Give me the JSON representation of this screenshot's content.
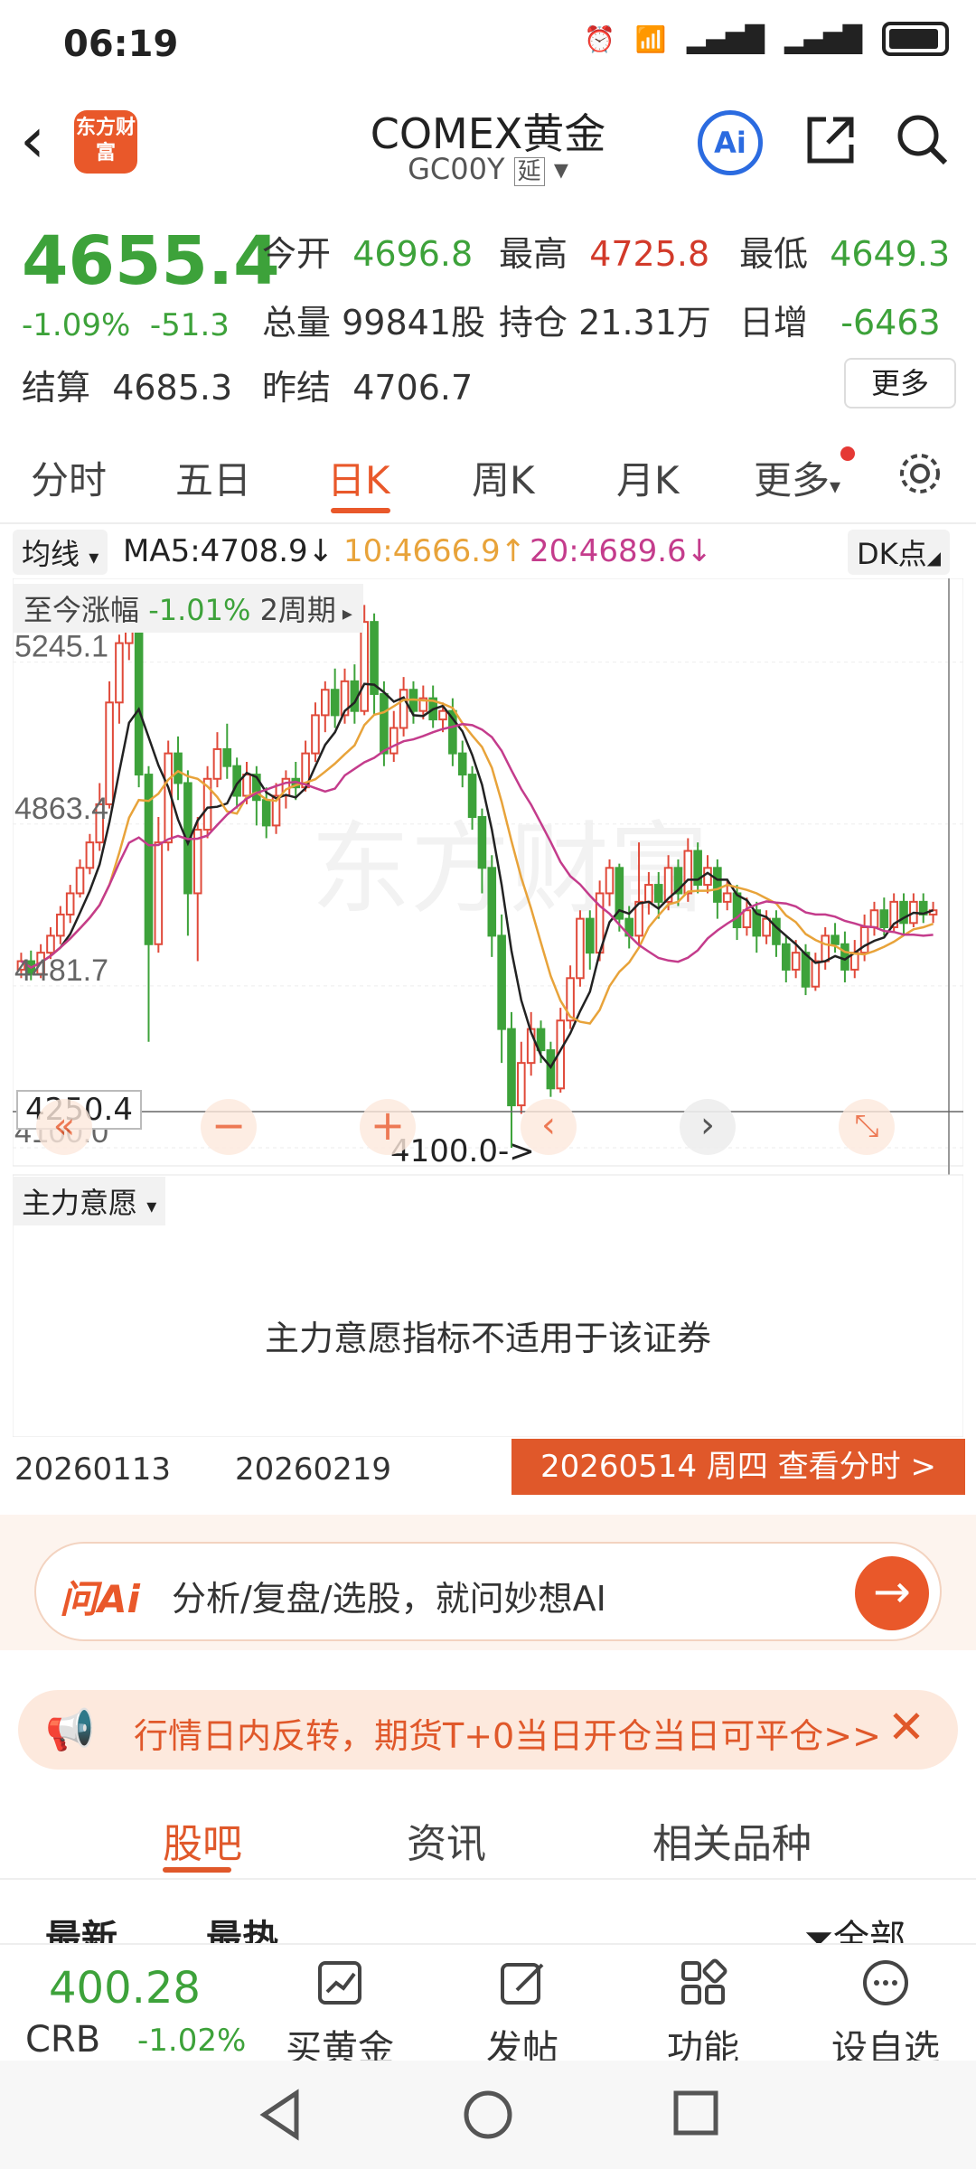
{
  "status": {
    "time": "06:19"
  },
  "header": {
    "title": "COMEX黄金",
    "code": "GC00Y",
    "delay_tag": "延",
    "logo_text": "东方财富",
    "ai_label": "Ai"
  },
  "quote": {
    "price": "4655.4",
    "change_pct": "-1.09%",
    "change": "-51.3",
    "open_label": "今开",
    "open": "4696.8",
    "high_label": "最高",
    "high": "4725.8",
    "low_label": "最低",
    "low": "4649.3",
    "volume_label": "总量",
    "volume": "99841股",
    "oi_label": "持仓",
    "oi": "21.31万",
    "daily_inc_label": "日增",
    "daily_inc": "-6463",
    "settle_label": "结算",
    "settle": "4685.3",
    "prev_settle_label": "昨结",
    "prev_settle": "4706.7",
    "more_label": "更多"
  },
  "tabs": [
    "分时",
    "五日",
    "日K",
    "周K",
    "月K",
    "更多"
  ],
  "active_tab": 2,
  "ma": {
    "selector": "均线",
    "ma5": "MA5:4708.9↓",
    "ma10": "10:4666.9↑",
    "ma20": "20:4689.6↓",
    "dk_label": "DK点",
    "ma5_color": "#222222",
    "ma10_color": "#e8a33a",
    "ma20_color": "#c43c8c"
  },
  "chart_overlay": {
    "range_label": "至今涨幅",
    "range_value": "-1.01%",
    "period": "2周期",
    "current_price_tag": "4250.4",
    "marker_text": "4100.0->",
    "indicator_selector": "主力意愿",
    "indicator_note": "主力意愿指标不适用于该证券"
  },
  "chart_data": {
    "type": "candlestick",
    "y_ticks": [
      "5245.1",
      "4863.4",
      "4481.7",
      "4100.0"
    ],
    "ylim": [
      4100.0,
      5400.0
    ],
    "x_labels": [
      "20260113",
      "20260219"
    ],
    "watermark": "东方财富",
    "up_color": "#e04a3a",
    "down_color": "#3da23a",
    "candles": [
      {
        "o": 4520,
        "c": 4540,
        "h": 4560,
        "l": 4500
      },
      {
        "o": 4540,
        "c": 4510,
        "h": 4565,
        "l": 4495
      },
      {
        "o": 4510,
        "c": 4560,
        "h": 4580,
        "l": 4500
      },
      {
        "o": 4560,
        "c": 4600,
        "h": 4620,
        "l": 4545
      },
      {
        "o": 4600,
        "c": 4650,
        "h": 4670,
        "l": 4580
      },
      {
        "o": 4650,
        "c": 4700,
        "h": 4720,
        "l": 4630
      },
      {
        "o": 4700,
        "c": 4760,
        "h": 4780,
        "l": 4690
      },
      {
        "o": 4760,
        "c": 4820,
        "h": 4840,
        "l": 4745
      },
      {
        "o": 4820,
        "c": 4910,
        "h": 4960,
        "l": 4800
      },
      {
        "o": 4910,
        "c": 5150,
        "h": 5200,
        "l": 4900
      },
      {
        "o": 5150,
        "c": 5290,
        "h": 5310,
        "l": 5100
      },
      {
        "o": 5290,
        "c": 5340,
        "h": 5360,
        "l": 5250
      },
      {
        "o": 5340,
        "c": 4980,
        "h": 5370,
        "l": 4950
      },
      {
        "o": 4980,
        "c": 4580,
        "h": 5000,
        "l": 4350
      },
      {
        "o": 4580,
        "c": 4820,
        "h": 4880,
        "l": 4560
      },
      {
        "o": 4820,
        "c": 5030,
        "h": 5060,
        "l": 4800
      },
      {
        "o": 5030,
        "c": 4960,
        "h": 5070,
        "l": 4920
      },
      {
        "o": 4960,
        "c": 4700,
        "h": 4990,
        "l": 4600
      },
      {
        "o": 4700,
        "c": 4850,
        "h": 4880,
        "l": 4540
      },
      {
        "o": 4850,
        "c": 4970,
        "h": 5000,
        "l": 4830
      },
      {
        "o": 4970,
        "c": 5040,
        "h": 5080,
        "l": 4950
      },
      {
        "o": 5040,
        "c": 5000,
        "h": 5100,
        "l": 4970
      },
      {
        "o": 5000,
        "c": 4930,
        "h": 5020,
        "l": 4900
      },
      {
        "o": 4930,
        "c": 4980,
        "h": 5010,
        "l": 4910
      },
      {
        "o": 4980,
        "c": 4920,
        "h": 5000,
        "l": 4860
      },
      {
        "o": 4920,
        "c": 4860,
        "h": 4950,
        "l": 4830
      },
      {
        "o": 4860,
        "c": 4930,
        "h": 4960,
        "l": 4840
      },
      {
        "o": 4930,
        "c": 4970,
        "h": 4990,
        "l": 4900
      },
      {
        "o": 4970,
        "c": 4950,
        "h": 5010,
        "l": 4920
      },
      {
        "o": 4950,
        "c": 5030,
        "h": 5060,
        "l": 4940
      },
      {
        "o": 5030,
        "c": 5120,
        "h": 5150,
        "l": 5010
      },
      {
        "o": 5120,
        "c": 5180,
        "h": 5200,
        "l": 5080
      },
      {
        "o": 5180,
        "c": 5120,
        "h": 5230,
        "l": 5090
      },
      {
        "o": 5120,
        "c": 5200,
        "h": 5230,
        "l": 5100
      },
      {
        "o": 5200,
        "c": 5130,
        "h": 5240,
        "l": 5100
      },
      {
        "o": 5130,
        "c": 5340,
        "h": 5380,
        "l": 5120
      },
      {
        "o": 5340,
        "c": 5170,
        "h": 5360,
        "l": 5120
      },
      {
        "o": 5170,
        "c": 5030,
        "h": 5200,
        "l": 5000
      },
      {
        "o": 5030,
        "c": 5090,
        "h": 5130,
        "l": 5010
      },
      {
        "o": 5090,
        "c": 5180,
        "h": 5210,
        "l": 5070
      },
      {
        "o": 5180,
        "c": 5130,
        "h": 5200,
        "l": 5100
      },
      {
        "o": 5130,
        "c": 5160,
        "h": 5190,
        "l": 5110
      },
      {
        "o": 5160,
        "c": 5110,
        "h": 5190,
        "l": 5090
      },
      {
        "o": 5110,
        "c": 5130,
        "h": 5150,
        "l": 5080
      },
      {
        "o": 5130,
        "c": 5030,
        "h": 5160,
        "l": 5000
      },
      {
        "o": 5030,
        "c": 4980,
        "h": 5060,
        "l": 4950
      },
      {
        "o": 4980,
        "c": 4880,
        "h": 5000,
        "l": 4850
      },
      {
        "o": 4880,
        "c": 4760,
        "h": 4900,
        "l": 4700
      },
      {
        "o": 4760,
        "c": 4600,
        "h": 4790,
        "l": 4550
      },
      {
        "o": 4600,
        "c": 4380,
        "h": 4650,
        "l": 4300
      },
      {
        "o": 4380,
        "c": 4200,
        "h": 4420,
        "l": 4100
      },
      {
        "o": 4200,
        "c": 4300,
        "h": 4350,
        "l": 4180
      },
      {
        "o": 4300,
        "c": 4380,
        "h": 4420,
        "l": 4270
      },
      {
        "o": 4380,
        "c": 4330,
        "h": 4400,
        "l": 4300
      },
      {
        "o": 4330,
        "c": 4240,
        "h": 4350,
        "l": 4220
      },
      {
        "o": 4240,
        "c": 4400,
        "h": 4430,
        "l": 4230
      },
      {
        "o": 4400,
        "c": 4500,
        "h": 4530,
        "l": 4380
      },
      {
        "o": 4500,
        "c": 4640,
        "h": 4660,
        "l": 4480
      },
      {
        "o": 4640,
        "c": 4560,
        "h": 4660,
        "l": 4520
      },
      {
        "o": 4560,
        "c": 4700,
        "h": 4730,
        "l": 4540
      },
      {
        "o": 4700,
        "c": 4760,
        "h": 4780,
        "l": 4670
      },
      {
        "o": 4760,
        "c": 4640,
        "h": 4770,
        "l": 4610
      },
      {
        "o": 4640,
        "c": 4600,
        "h": 4670,
        "l": 4570
      },
      {
        "o": 4600,
        "c": 4680,
        "h": 4820,
        "l": 4580
      },
      {
        "o": 4680,
        "c": 4720,
        "h": 4750,
        "l": 4650
      },
      {
        "o": 4720,
        "c": 4680,
        "h": 4750,
        "l": 4640
      },
      {
        "o": 4680,
        "c": 4760,
        "h": 4790,
        "l": 4660
      },
      {
        "o": 4760,
        "c": 4700,
        "h": 4780,
        "l": 4670
      },
      {
        "o": 4700,
        "c": 4800,
        "h": 4830,
        "l": 4680
      },
      {
        "o": 4800,
        "c": 4720,
        "h": 4820,
        "l": 4700
      },
      {
        "o": 4720,
        "c": 4760,
        "h": 4790,
        "l": 4700
      },
      {
        "o": 4760,
        "c": 4680,
        "h": 4780,
        "l": 4640
      },
      {
        "o": 4680,
        "c": 4700,
        "h": 4730,
        "l": 4660
      },
      {
        "o": 4700,
        "c": 4620,
        "h": 4720,
        "l": 4590
      },
      {
        "o": 4620,
        "c": 4660,
        "h": 4690,
        "l": 4600
      },
      {
        "o": 4660,
        "c": 4600,
        "h": 4680,
        "l": 4560
      },
      {
        "o": 4600,
        "c": 4640,
        "h": 4660,
        "l": 4580
      },
      {
        "o": 4640,
        "c": 4580,
        "h": 4660,
        "l": 4550
      },
      {
        "o": 4580,
        "c": 4520,
        "h": 4600,
        "l": 4490
      },
      {
        "o": 4520,
        "c": 4560,
        "h": 4590,
        "l": 4500
      },
      {
        "o": 4560,
        "c": 4480,
        "h": 4580,
        "l": 4460
      },
      {
        "o": 4480,
        "c": 4540,
        "h": 4560,
        "l": 4470
      },
      {
        "o": 4540,
        "c": 4600,
        "h": 4620,
        "l": 4520
      },
      {
        "o": 4600,
        "c": 4580,
        "h": 4630,
        "l": 4560
      },
      {
        "o": 4580,
        "c": 4520,
        "h": 4610,
        "l": 4490
      },
      {
        "o": 4520,
        "c": 4560,
        "h": 4590,
        "l": 4500
      },
      {
        "o": 4560,
        "c": 4620,
        "h": 4650,
        "l": 4540
      },
      {
        "o": 4620,
        "c": 4660,
        "h": 4680,
        "l": 4600
      },
      {
        "o": 4660,
        "c": 4620,
        "h": 4690,
        "l": 4600
      },
      {
        "o": 4620,
        "c": 4680,
        "h": 4700,
        "l": 4610
      },
      {
        "o": 4680,
        "c": 4630,
        "h": 4700,
        "l": 4600
      },
      {
        "o": 4630,
        "c": 4680,
        "h": 4700,
        "l": 4620
      },
      {
        "o": 4680,
        "c": 4650,
        "h": 4700,
        "l": 4630
      },
      {
        "o": 4650,
        "c": 4660,
        "h": 4680,
        "l": 4630
      }
    ]
  },
  "date_button": "20260514 周四 查看分时 >",
  "ask": {
    "logo": "问Ai",
    "text": "分析/复盘/选股，就问妙想AI"
  },
  "banner": {
    "text": "行情日内反转，期货T+0当日开仓当日可平仓>>"
  },
  "bottom_tabs": [
    "股吧",
    "资讯",
    "相关品种"
  ],
  "filters": {
    "left1": "最新",
    "left2": "最热",
    "right": "全部"
  },
  "dock": {
    "price": "400.28",
    "name": "CRB",
    "change": "-1.02%",
    "items": [
      "买黄金",
      "发帖",
      "功能",
      "设自选"
    ]
  }
}
